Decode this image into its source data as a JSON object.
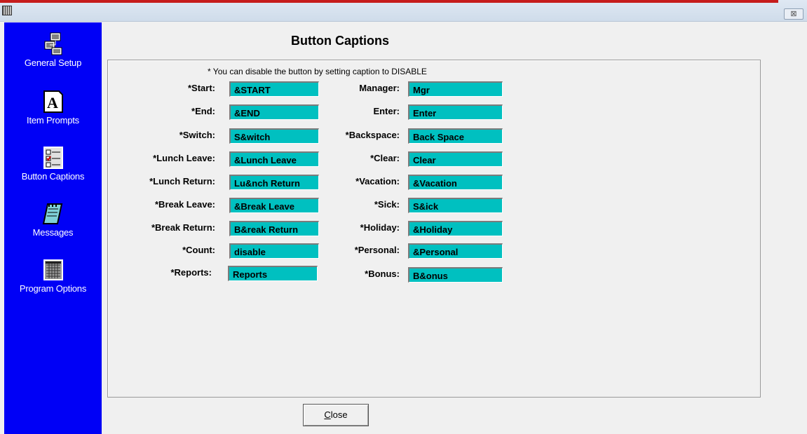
{
  "window": {
    "close_glyph": "⊠"
  },
  "sidebar": {
    "items": [
      {
        "label": "General Setup",
        "icon": "network-computer-icon"
      },
      {
        "label": "Item Prompts",
        "icon": "font-letter-icon"
      },
      {
        "label": "Button Captions",
        "icon": "checklist-icon"
      },
      {
        "label": "Messages",
        "icon": "notepad-icon"
      },
      {
        "label": "Program Options",
        "icon": "calendar-grid-icon"
      }
    ]
  },
  "panel": {
    "title": "Button Captions",
    "hint": "* You can disable the button by setting caption to DISABLE",
    "left_fields": [
      {
        "label": "*Start:",
        "value": "&START"
      },
      {
        "label": "*End:",
        "value": "&END"
      },
      {
        "label": "*Switch:",
        "value": "S&witch"
      },
      {
        "label": "*Lunch Leave:",
        "value": "&Lunch Leave"
      },
      {
        "label": "*Lunch Return:",
        "value": "Lu&nch Return"
      },
      {
        "label": "*Break Leave:",
        "value": "&Break Leave"
      },
      {
        "label": "*Break Return:",
        "value": "B&reak Return"
      },
      {
        "label": "*Count:",
        "value": "disable"
      },
      {
        "label": "*Reports:",
        "value": "Reports"
      }
    ],
    "right_fields": [
      {
        "label": "Manager:",
        "value": "Mgr"
      },
      {
        "label": "Enter:",
        "value": "Enter"
      },
      {
        "label": "*Backspace:",
        "value": "Back Space"
      },
      {
        "label": "*Clear:",
        "value": "Clear"
      },
      {
        "label": "*Vacation:",
        "value": "&Vacation"
      },
      {
        "label": "*Sick:",
        "value": "S&ick"
      },
      {
        "label": "*Holiday:",
        "value": "&Holiday"
      },
      {
        "label": "*Personal:",
        "value": "&Personal"
      },
      {
        "label": "*Bonus:",
        "value": "B&onus"
      }
    ]
  },
  "footer": {
    "close_first": "C",
    "close_rest": "lose"
  },
  "colors": {
    "sidebar": "#0000f6",
    "field": "#00c0c0"
  }
}
